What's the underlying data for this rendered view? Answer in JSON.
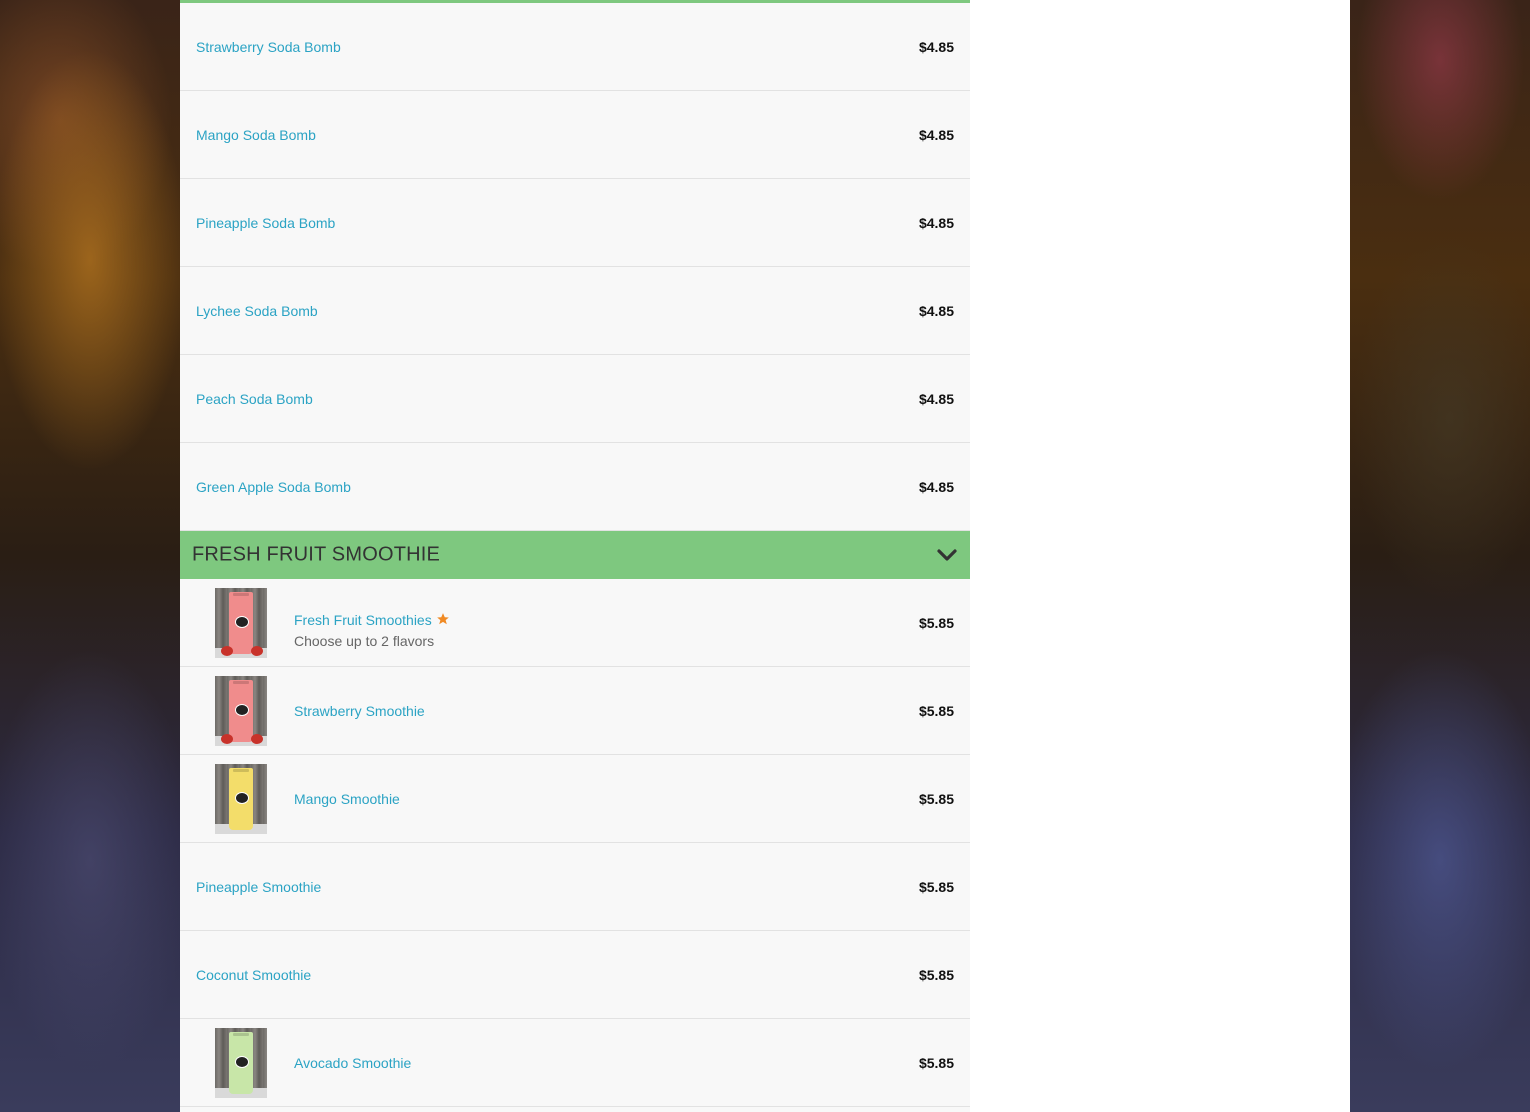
{
  "colors": {
    "accent_green": "#7ec87f",
    "link_blue": "#2ba3c4",
    "star_orange": "#f08a24"
  },
  "soda_items": [
    {
      "name": "Strawberry Soda Bomb",
      "price": "$4.85"
    },
    {
      "name": "Mango Soda Bomb",
      "price": "$4.85"
    },
    {
      "name": "Pineapple Soda Bomb",
      "price": "$4.85"
    },
    {
      "name": "Lychee Soda Bomb",
      "price": "$4.85"
    },
    {
      "name": "Peach Soda Bomb",
      "price": "$4.85"
    },
    {
      "name": "Green Apple Soda Bomb",
      "price": "$4.85"
    }
  ],
  "smoothie_section": {
    "title": "FRESH FRUIT SMOOTHIE",
    "toggle_icon": "chevron-down-icon",
    "items": [
      {
        "name": "Fresh Fruit Smoothies",
        "description": "Choose up to 2 flavors",
        "price": "$5.85",
        "featured_icon": "star-icon",
        "thumbnail": "strawberry-smoothie-cup"
      },
      {
        "name": "Strawberry Smoothie",
        "price": "$5.85",
        "thumbnail": "strawberry-smoothie-cup"
      },
      {
        "name": "Mango Smoothie",
        "price": "$5.85",
        "thumbnail": "mango-smoothie-cup"
      },
      {
        "name": "Pineapple Smoothie",
        "price": "$5.85"
      },
      {
        "name": "Coconut Smoothie",
        "price": "$5.85"
      },
      {
        "name": "Avocado Smoothie",
        "price": "$5.85",
        "thumbnail": "avocado-smoothie-cup"
      }
    ]
  }
}
